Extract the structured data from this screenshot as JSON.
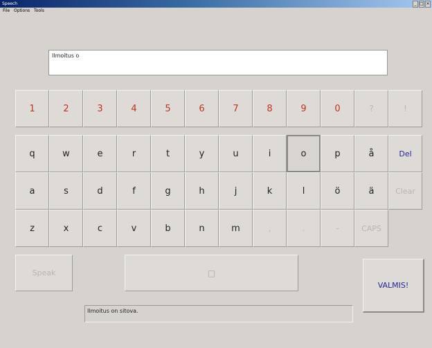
{
  "window": {
    "title": "Speech",
    "controls": [
      "_",
      "□",
      "×"
    ]
  },
  "menu": [
    "File",
    "Options",
    "Tools"
  ],
  "input": {
    "value": "Ilmoitus o"
  },
  "keys": {
    "row1": [
      "1",
      "2",
      "3",
      "4",
      "5",
      "6",
      "7",
      "8",
      "9",
      "0",
      "?",
      "!"
    ],
    "row2": [
      "q",
      "w",
      "e",
      "r",
      "t",
      "y",
      "u",
      "i",
      "o",
      "p",
      "å",
      "Del"
    ],
    "row3": [
      "a",
      "s",
      "d",
      "f",
      "g",
      "h",
      "j",
      "k",
      "l",
      "ö",
      "ä",
      "Clear"
    ],
    "row4": [
      "z",
      "x",
      "c",
      "v",
      "b",
      "n",
      "m",
      ",",
      ".",
      "-",
      "CAPS"
    ]
  },
  "buttons": {
    "speak": "Speak",
    "space": "□",
    "done": "VALMIS!"
  },
  "status": {
    "text": "Ilmoitus on sitova."
  },
  "colors": {
    "number_keys": "#c0311e",
    "action_keys": "#24249c",
    "disabled": "#b9b6b1"
  }
}
